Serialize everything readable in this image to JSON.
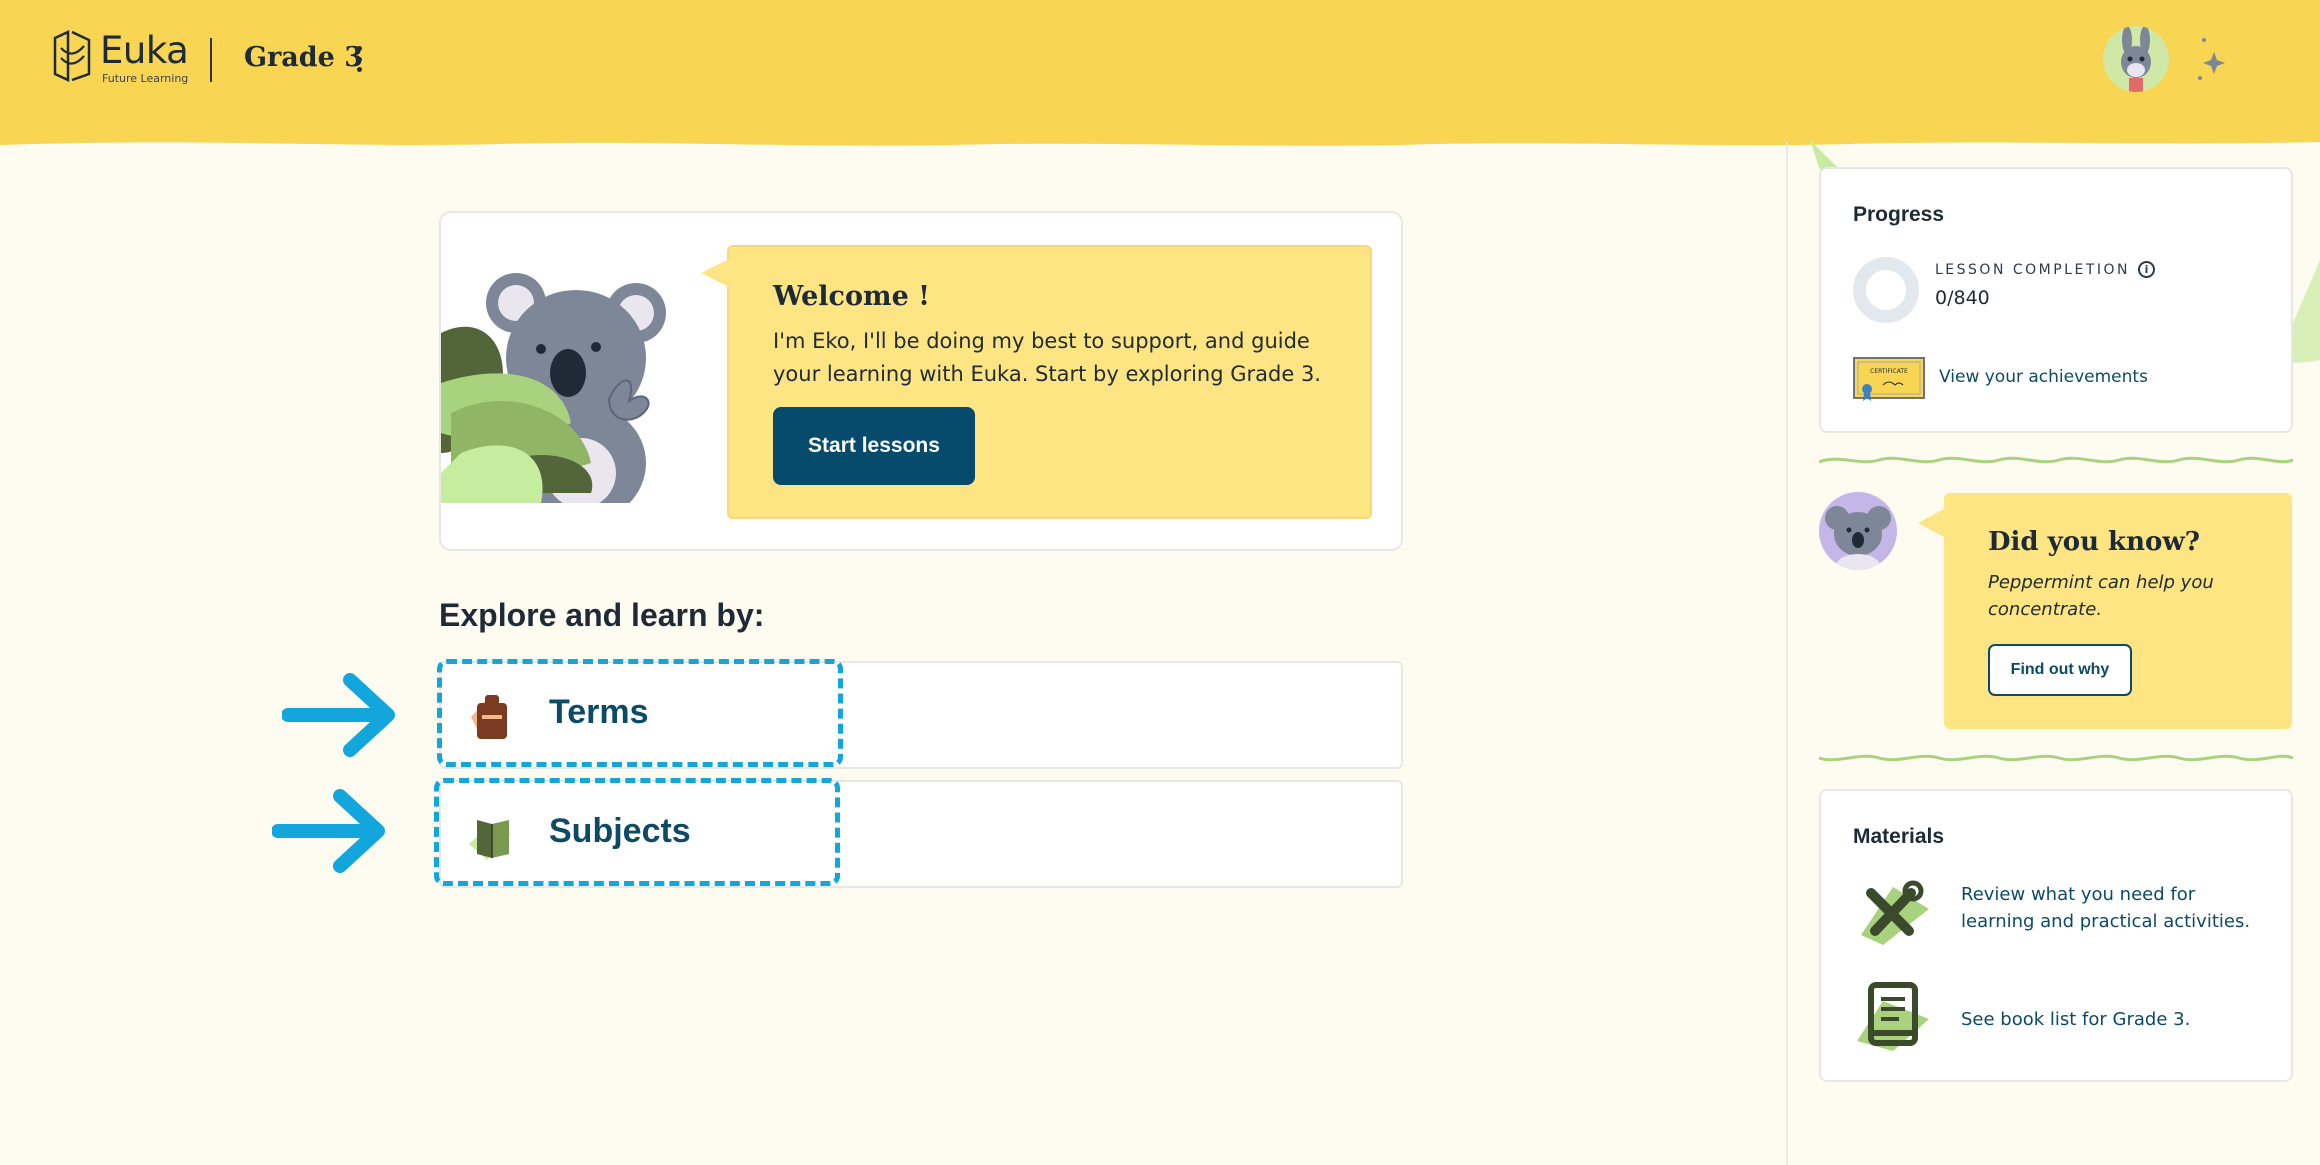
{
  "header": {
    "brand_name": "Euka",
    "brand_tagline": "Future Learning",
    "grade_label": "Grade 3"
  },
  "welcome": {
    "title": "Welcome !",
    "body": "I'm Eko, I'll be doing my best to support, and guide your learning with Euka. Start by exploring Grade 3.",
    "start_button": "Start lessons"
  },
  "explore": {
    "title": "Explore and learn by:",
    "items": [
      {
        "label": "Terms",
        "icon": "calendar-icon"
      },
      {
        "label": "Subjects",
        "icon": "book-icon"
      }
    ]
  },
  "progress": {
    "title": "Progress",
    "completion_label": "LESSON COMPLETION",
    "completion_value": "0/840",
    "completion_fraction": 0,
    "certificate_text": "CERTIFICATE",
    "achievements_link": "View your achievements"
  },
  "tip": {
    "title": "Did you know?",
    "body": "Peppermint can help you concentrate.",
    "button": "Find out why"
  },
  "materials": {
    "title": "Materials",
    "items": [
      {
        "text": "Review what you need for learning and practical activities.",
        "icon": "tools-icon"
      },
      {
        "text": "See book list for Grade 3.",
        "icon": "book-list-icon"
      }
    ]
  },
  "colors": {
    "header_bg": "#f8d553",
    "page_bg": "#fefbf0",
    "primary": "#064b6b",
    "speech_bg": "#fde583",
    "highlight_dash": "#12a6dd",
    "leaf_green": "#c6eca0"
  }
}
